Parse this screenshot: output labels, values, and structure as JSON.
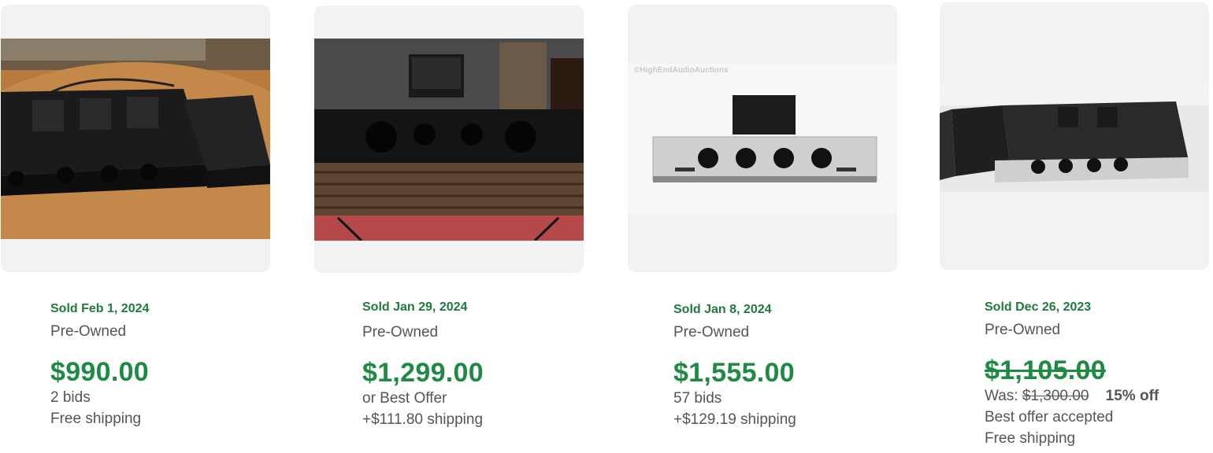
{
  "listings": [
    {
      "sold": "Sold Feb 1, 2024",
      "condition": "Pre-Owned",
      "price": "$990.00",
      "detail1": "2 bids",
      "detail2": "Free shipping"
    },
    {
      "sold": "Sold Jan 29, 2024",
      "condition": "Pre-Owned",
      "price": "$1,299.00",
      "detail1": "or Best Offer",
      "detail2": "+$111.80 shipping"
    },
    {
      "sold": "Sold Jan 8, 2024",
      "condition": "Pre-Owned",
      "price": "$1,555.00",
      "detail1": "57 bids",
      "detail2": "+$129.19 shipping",
      "watermark": "©HighEndAudioAuctions"
    },
    {
      "sold": "Sold Dec 26, 2023",
      "condition": "Pre-Owned",
      "price": "$1,105.00",
      "was_label": "Was:",
      "was_price": "$1,300.00",
      "discount": "15% off",
      "detail1": "Best offer accepted",
      "detail2": "Free shipping"
    }
  ],
  "colors": {
    "sold_green": "#1f7a3e",
    "price_green": "#1f8a43",
    "secondary_text": "#555555",
    "image_bg": "#f2f2f2"
  }
}
